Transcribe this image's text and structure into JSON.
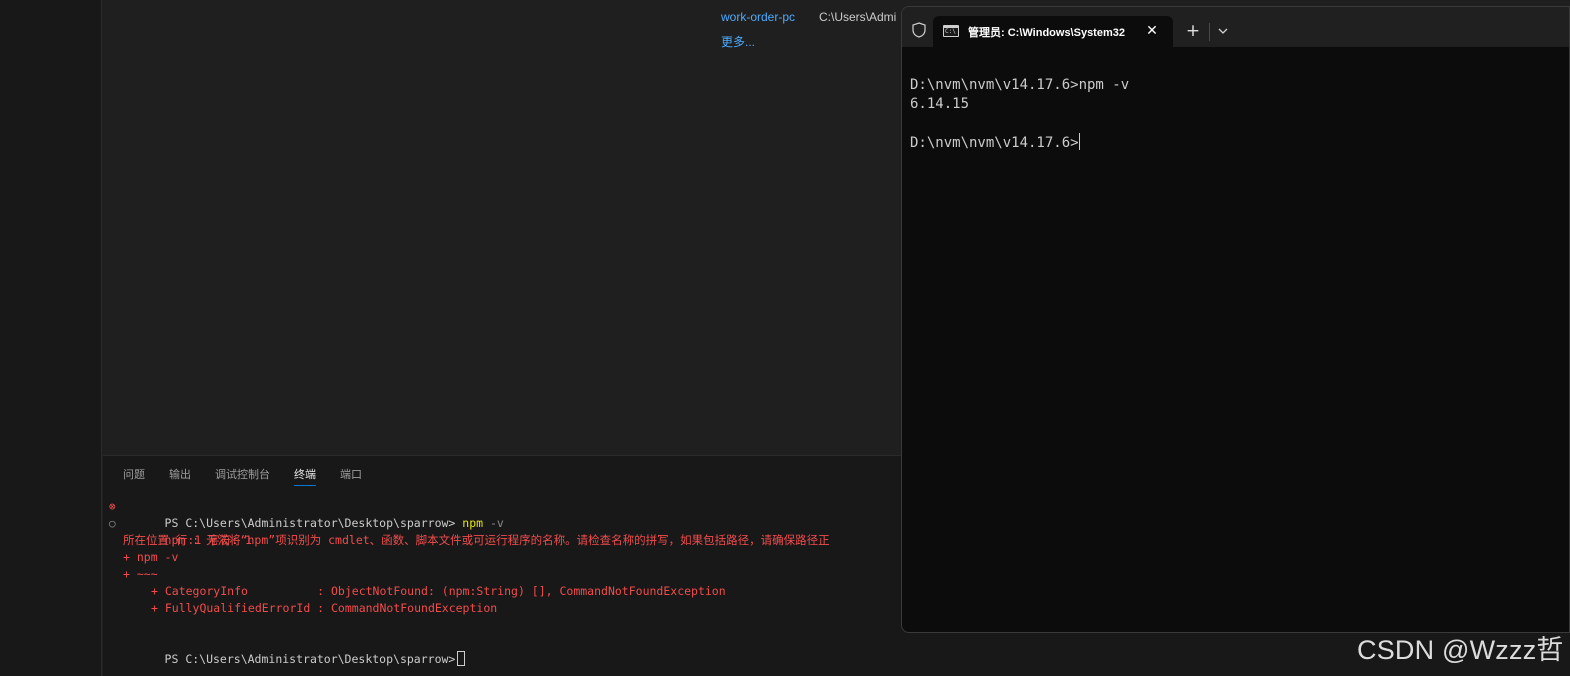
{
  "editor": {
    "recent": {
      "name": "work-order-pc",
      "path": "C:\\Users\\Admi",
      "more": "更多..."
    }
  },
  "panel": {
    "tabs": [
      {
        "label": "问题"
      },
      {
        "label": "输出"
      },
      {
        "label": "调试控制台"
      },
      {
        "label": "终端",
        "active": true
      },
      {
        "label": "端口"
      }
    ],
    "terminal": {
      "prompt1": "PS C:\\Users\\Administrator\\Desktop\\sparrow>",
      "cmd": "npm",
      "arg": "-v",
      "error_line1": "npm : 无法将“npm”项识别为 cmdlet、函数、脚本文件或可运行程序的名称。请检查名称的拼写，如果包括路径，请确保路径正",
      "error_line2": "所在位置 行:1 字符: 1",
      "error_line3": "+ npm -v",
      "error_line4": "+ ~~~",
      "error_line5": "+ CategoryInfo          : ObjectNotFound: (npm:String) [], CommandNotFoundException",
      "error_line6": "+ FullyQualifiedErrorId : CommandNotFoundException",
      "prompt2": "PS C:\\Users\\Administrator\\Desktop\\sparrow>"
    }
  },
  "windows_terminal": {
    "tab_title": "管理员: C:\\Windows\\System32",
    "tab_icon_text": "C:\\",
    "lines": [
      "D:\\nvm\\nvm\\v14.17.6>npm -v",
      "6.14.15",
      "",
      "D:\\nvm\\nvm\\v14.17.6>"
    ]
  },
  "watermark": "CSDN @Wzzz哲"
}
